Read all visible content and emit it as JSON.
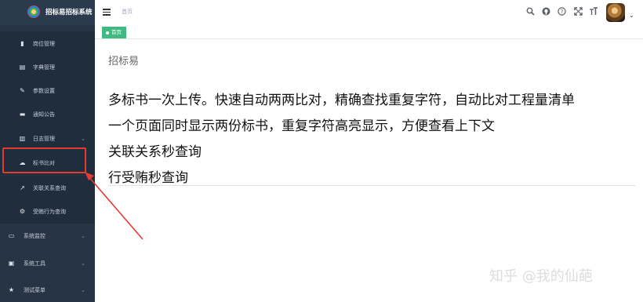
{
  "app": {
    "title": "招标易招标系统"
  },
  "sidebar": {
    "items": [
      {
        "icon": "id-card-icon",
        "label": "岗位管理",
        "group": false
      },
      {
        "icon": "book-icon",
        "label": "字典管理",
        "group": false
      },
      {
        "icon": "edit-icon",
        "label": "参数设置",
        "group": false
      },
      {
        "icon": "message-icon",
        "label": "通知公告",
        "group": false
      },
      {
        "icon": "log-icon",
        "label": "日志管理",
        "group": true
      },
      {
        "icon": "cloud-icon",
        "label": "标书比对",
        "group": false,
        "highlighted": true
      },
      {
        "icon": "link-icon",
        "label": "关联关系查询",
        "group": false
      },
      {
        "icon": "gear-icon",
        "label": "受贿行为查询",
        "group": false
      },
      {
        "icon": "monitor-icon",
        "label": "系统监控",
        "group": true
      },
      {
        "icon": "toolbox-icon",
        "label": "系统工具",
        "group": true
      },
      {
        "icon": "star-icon",
        "label": "测试菜单",
        "group": true
      }
    ]
  },
  "header": {
    "breadcrumb": "首页",
    "tools": [
      "search-icon",
      "github-icon",
      "question-icon",
      "fullscreen-icon",
      "font-size-icon"
    ]
  },
  "tags": [
    {
      "label": "首页",
      "active": true
    }
  ],
  "main": {
    "title": "招标易",
    "features": [
      "多标书一次上传。快速自动两两比对，精确查找重复字符，自动比对工程量清单",
      "一个页面同时显示两份标书，重复字符高亮显示，方便查看上下文",
      "关联关系秒查询",
      "行受贿秒查询"
    ]
  },
  "watermark": "知乎 @我的仙葩",
  "colors": {
    "sidebar_bg": "#263445",
    "accent_green": "#42b983",
    "highlight_red": "#e33b2f"
  }
}
